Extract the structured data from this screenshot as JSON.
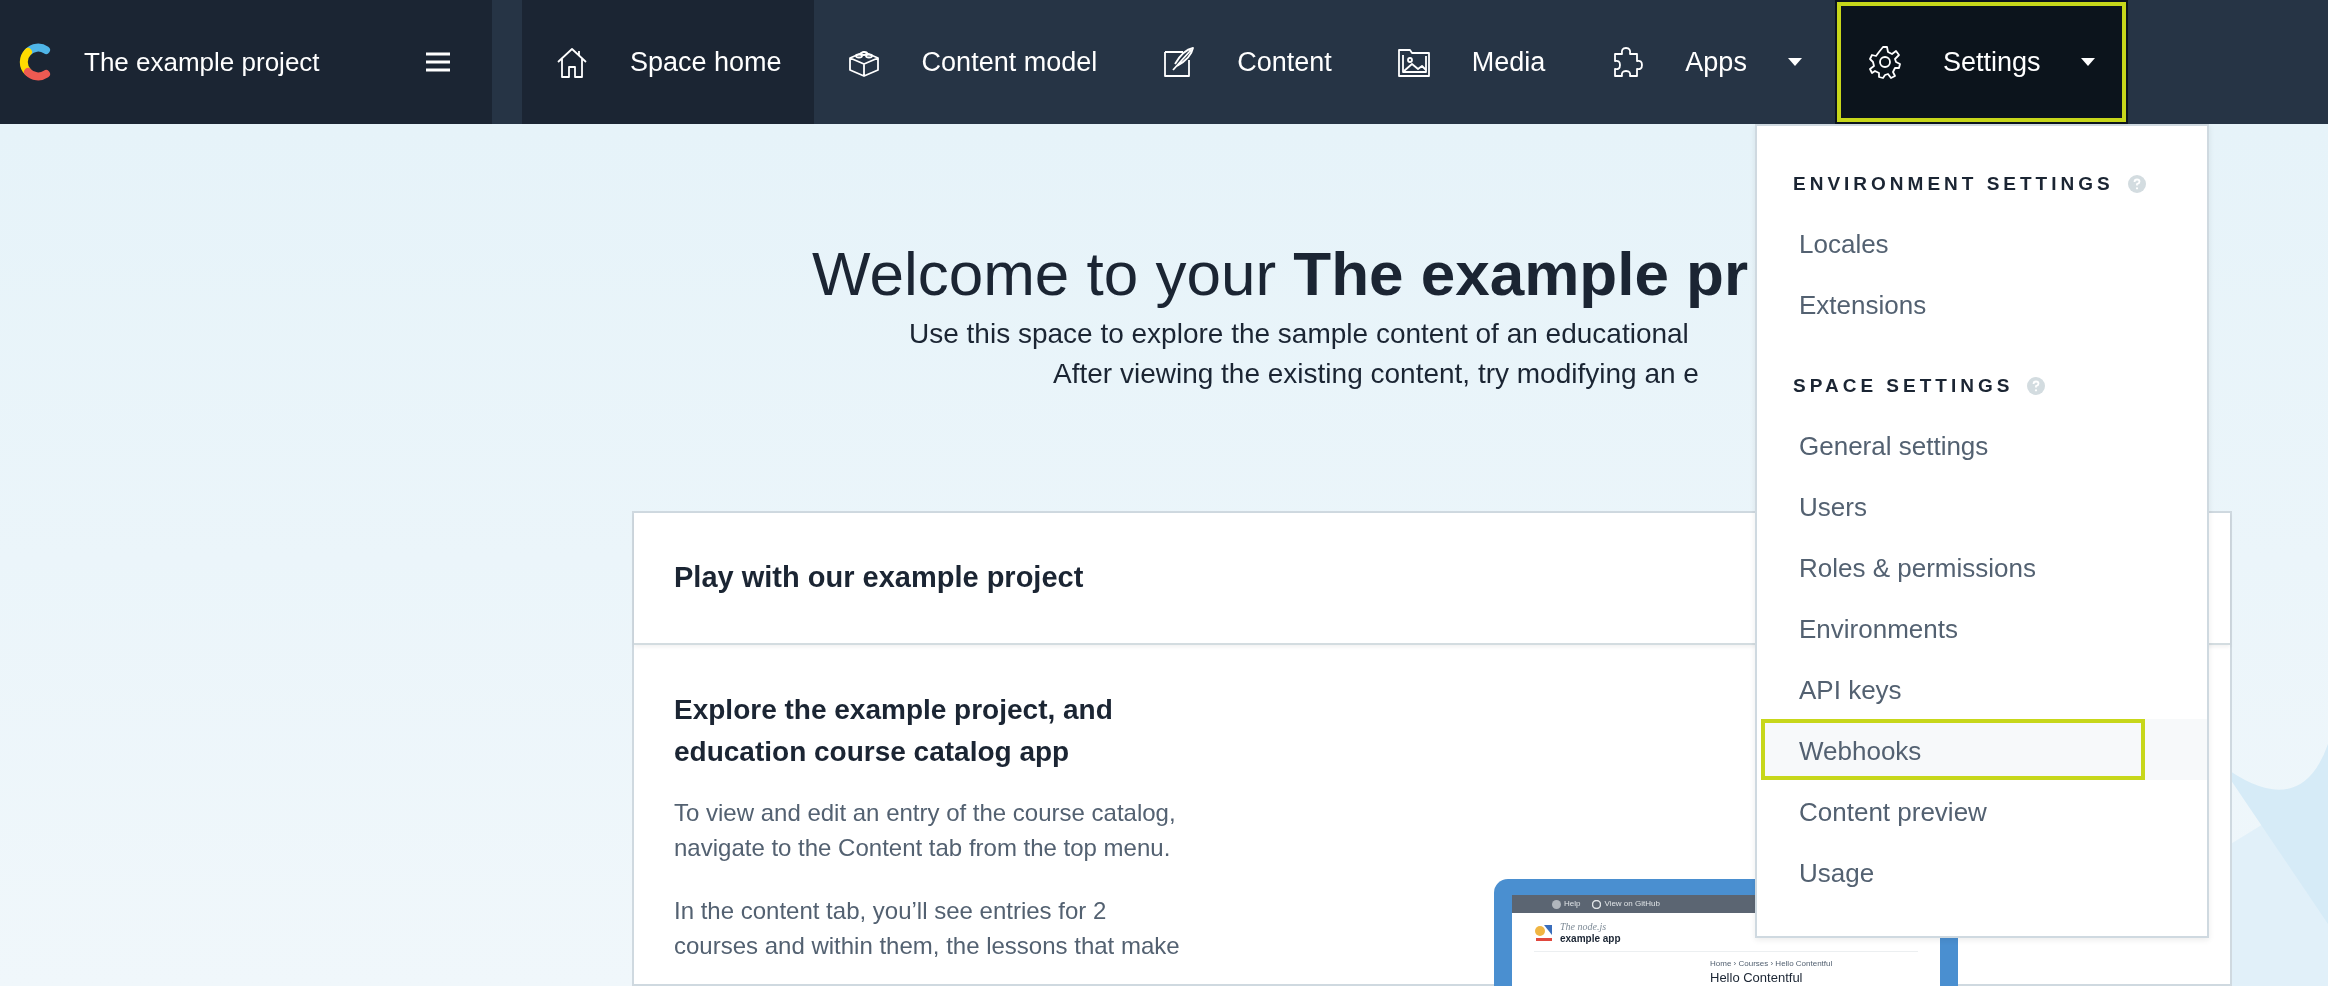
{
  "header": {
    "project_name": "The example project"
  },
  "nav_tabs": [
    {
      "label": "Space home",
      "kind": "link",
      "selected": true,
      "expanded": false,
      "highlighted": false
    },
    {
      "label": "Content model",
      "kind": "link",
      "selected": false,
      "expanded": false,
      "highlighted": false
    },
    {
      "label": "Content",
      "kind": "link",
      "selected": false,
      "expanded": false,
      "highlighted": false
    },
    {
      "label": "Media",
      "kind": "link",
      "selected": false,
      "expanded": false,
      "highlighted": false
    },
    {
      "label": "Apps",
      "kind": "dropdown",
      "selected": false,
      "expanded": false,
      "highlighted": false
    },
    {
      "label": "Settings",
      "kind": "dropdown",
      "selected": false,
      "expanded": true,
      "highlighted": true
    }
  ],
  "hero": {
    "title": "Welcome to your **The example pr**",
    "lines": [
      "Use this space to explore the sample content of an educational",
      "After viewing the existing content, try modifying an e"
    ]
  },
  "card": {
    "header": "Play with our example project",
    "heading_lines": [
      "Explore the example project, and",
      "education course catalog app"
    ],
    "paragraphs": [
      [
        "To view and edit an entry of the course catalog,",
        "navigate to the Content tab from the top menu."
      ],
      [
        "In the content tab, you’ll see entries for 2",
        "courses and within them, the lessons that make"
      ]
    ],
    "preview": {
      "toolbar": [
        "Help",
        "View on GitHub"
      ],
      "brand": [
        "The node.js",
        "example app"
      ],
      "breadcrumb": "Home › Courses › Hello Contentful",
      "title": "Hello Contentful"
    }
  },
  "settings_menu": {
    "sections": [
      {
        "heading": "ENVIRONMENT SETTINGS",
        "items": [
          {
            "label": "Locales",
            "highlighted": false
          },
          {
            "label": "Extensions",
            "highlighted": false
          }
        ]
      },
      {
        "heading": "SPACE SETTINGS",
        "items": [
          {
            "label": "General settings",
            "highlighted": false
          },
          {
            "label": "Users",
            "highlighted": false
          },
          {
            "label": "Roles & permissions",
            "highlighted": false
          },
          {
            "label": "Environments",
            "highlighted": false
          },
          {
            "label": "API keys",
            "highlighted": false
          },
          {
            "label": "Webhooks",
            "highlighted": true
          },
          {
            "label": "Content preview",
            "highlighted": false
          },
          {
            "label": "Usage",
            "highlighted": false
          }
        ]
      }
    ]
  }
}
